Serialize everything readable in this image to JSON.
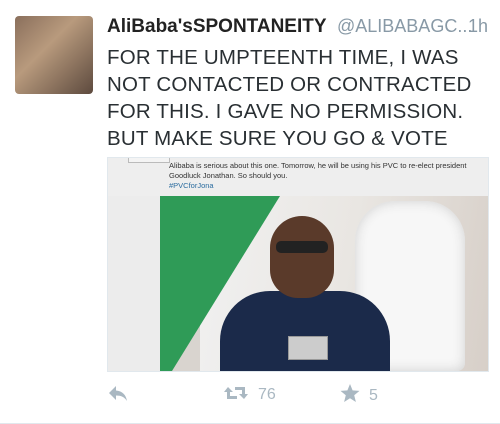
{
  "tweet": {
    "display_name": "AliBaba'sSPONTANEITY",
    "handle": "@ALIBABAGC...",
    "time": "1h",
    "text": "FOR THE UMPTEENTH TIME, I WAS NOT CONTACTED OR CONTRACTED FOR THIS. I GAVE NO PERMISSION. BUT MAKE SURE YOU GO & VOTE",
    "media": {
      "caption": "Alibaba is serious about this one. Tomorrow, he will be using his PVC to re-elect president Goodluck Jonathan. So should you.",
      "hashtag": "#PVCforJona"
    },
    "actions": {
      "reply_icon": "reply-icon",
      "retweet_icon": "retweet-icon",
      "retweet_count": "76",
      "favorite_icon": "star-icon",
      "favorite_count": "5"
    }
  },
  "colors": {
    "name": "#222222",
    "meta": "#8899a6",
    "text": "#292f33",
    "action": "#aab8c2",
    "green": "#2f9b57"
  }
}
